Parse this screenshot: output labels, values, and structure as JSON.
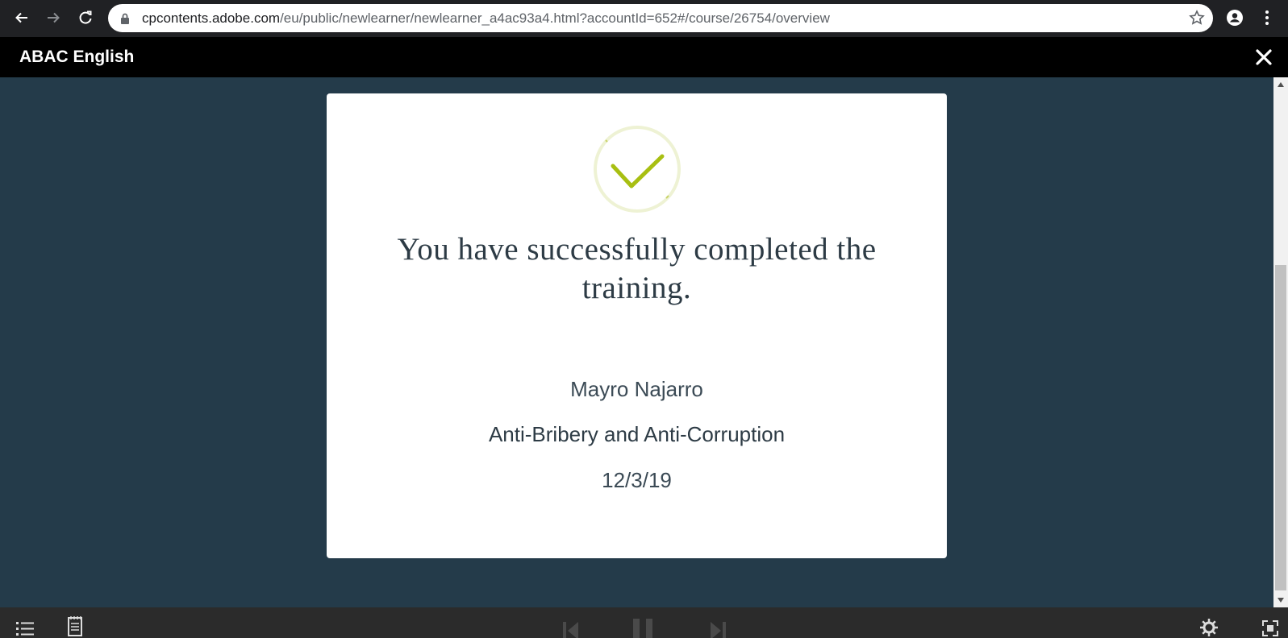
{
  "browser": {
    "url_host": "cpcontents.adobe.com",
    "url_path": "/eu/public/newlearner/newlearner_a4ac93a4.html?accountId=652#/course/26754/overview"
  },
  "app": {
    "title": "ABAC English"
  },
  "certificate": {
    "heading": "You have successfully completed the training.",
    "learner_name": "Mayro Najarro",
    "course_name": "Anti-Bribery and Anti-Corruption",
    "date": "12/3/19"
  },
  "icons": {
    "back": "back-arrow-icon",
    "forward": "forward-arrow-icon",
    "reload": "reload-icon",
    "lock": "lock-icon",
    "bookmark": "star-icon",
    "profile": "account-icon",
    "menu": "more-vert-icon",
    "close": "close-icon",
    "check": "checkmark-icon",
    "toc": "list-icon",
    "notes": "notepad-icon",
    "prev": "skip-previous-icon",
    "pause": "pause-icon",
    "next": "skip-next-icon",
    "settings": "gear-icon",
    "fullscreen": "fullscreen-icon"
  },
  "colors": {
    "content_bg": "#243b4a",
    "check_green": "#a8bf12",
    "check_ring": "#eef2d4"
  }
}
